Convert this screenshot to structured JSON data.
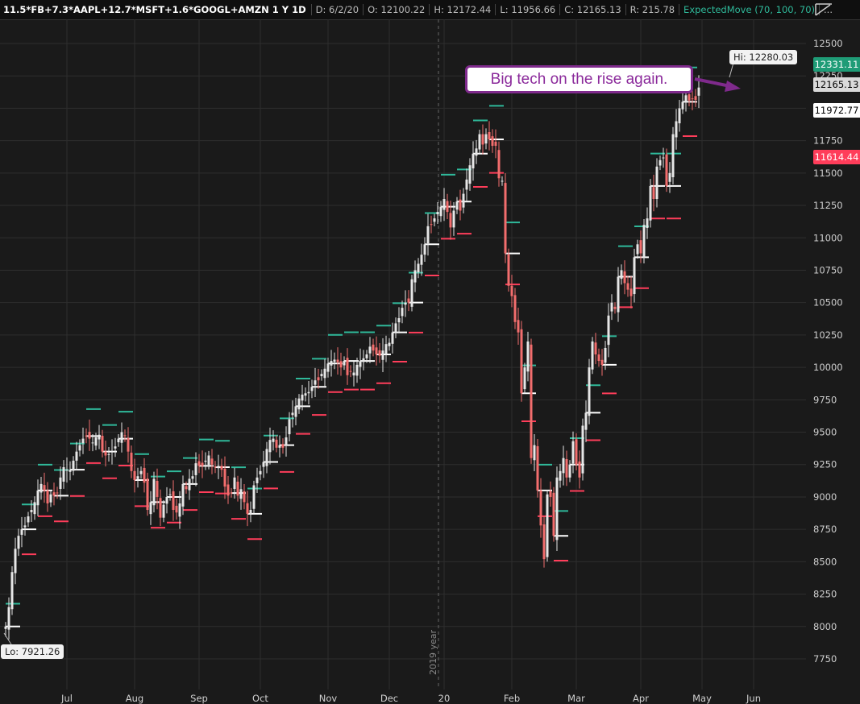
{
  "header": {
    "symbol": "11.5*FB+7.3*AAPL+12.7*MSFT+1.6*GOOGL+AMZN 1 Y 1D",
    "date": "D: 6/2/20",
    "open": "O: 12100.22",
    "high": "H: 12172.44",
    "low": "L: 11956.66",
    "close": "C: 12165.13",
    "range": "R: 215.78",
    "study": "ExpectedMove (70, 100, 70)",
    "more": "..."
  },
  "colors": {
    "up": "#e6e6e6",
    "down": "#f26d6d",
    "upper_band": "#2fb99a",
    "lower_band": "#ff3d5a",
    "background": "#1a1a1a",
    "grid": "#2e2e2e"
  },
  "annotation": {
    "text": "Big tech on the rise again."
  },
  "price_tags": [
    {
      "text": "12331.11",
      "bg": "#1f9c77",
      "fg": "#ffffff"
    },
    {
      "text": "12165.13",
      "bg": "#d9d9d9",
      "fg": "#000000"
    },
    {
      "text": "11972.77",
      "bg": "#ffffff",
      "fg": "#000000"
    },
    {
      "text": "11614.44",
      "bg": "#ff3d5a",
      "fg": "#ffffff"
    }
  ],
  "hi_label": "Hi: 12280.03",
  "lo_label": "Lo: 7921.26",
  "year_marker": "2019 year",
  "chart_data": {
    "type": "candlestick",
    "ylim": [
      7500,
      12600
    ],
    "y_ticks": [
      7750,
      8000,
      8250,
      8500,
      8750,
      9000,
      9250,
      9500,
      9750,
      10000,
      10250,
      10500,
      10750,
      11000,
      11250,
      11500,
      11750,
      12000,
      12250,
      12500
    ],
    "x_ticks": [
      "Jul",
      "Aug",
      "Sep",
      "Oct",
      "Nov",
      "Dec",
      "20",
      "Feb",
      "Mar",
      "Apr",
      "May",
      "Jun"
    ],
    "x_tick_index": [
      19,
      40,
      60,
      79,
      100,
      119,
      136,
      157,
      177,
      197,
      216,
      232
    ],
    "hi": 12280.03,
    "lo": 7921.26,
    "closes": [
      8000,
      8150,
      8420,
      8600,
      8700,
      8750,
      8780,
      8850,
      8900,
      8960,
      9050,
      9100,
      9050,
      8950,
      9020,
      9010,
      9030,
      9150,
      9230,
      9210,
      9210,
      9280,
      9350,
      9400,
      9450,
      9470,
      9450,
      9420,
      9460,
      9480,
      9350,
      9320,
      9330,
      9350,
      9390,
      9450,
      9500,
      9470,
      9350,
      9200,
      9130,
      9160,
      9200,
      9110,
      8900,
      8960,
      9140,
      9000,
      8840,
      8940,
      9000,
      9020,
      8900,
      8880,
      8950,
      9100,
      9060,
      9140,
      9160,
      9260,
      9240,
      9240,
      9280,
      9320,
      9250,
      9230,
      9240,
      9210,
      9080,
      9010,
      9030,
      9150,
      9010,
      9060,
      8960,
      8870,
      8900,
      9090,
      9150,
      9200,
      9270,
      9370,
      9440,
      9450,
      9380,
      9400,
      9380,
      9460,
      9600,
      9650,
      9700,
      9760,
      9790,
      9800,
      9810,
      9850,
      9900,
      9900,
      9950,
      9990,
      10030,
      10050,
      10060,
      10040,
      10000,
      10050,
      9940,
      9970,
      9960,
      10020,
      10050,
      10070,
      10100,
      10160,
      10130,
      10100,
      10090,
      10130,
      10180,
      10190,
      10270,
      10340,
      10380,
      10460,
      10500,
      10500,
      10680,
      10750,
      10800,
      10870,
      10950,
      11090,
      11100,
      11150,
      11200,
      11240,
      11300,
      11200,
      11080,
      11210,
      11280,
      11210,
      11340,
      11450,
      11560,
      11650,
      11690,
      11800,
      11720,
      11800,
      11760,
      11710,
      11710,
      11460,
      11440,
      10880,
      10630,
      10550,
      10350,
      10270,
      9800,
      10000,
      10200,
      9300,
      9400,
      9050,
      8780,
      8520,
      9020,
      9000,
      8700,
      9150,
      9200,
      9300,
      9150,
      9250,
      9430,
      9250,
      9150,
      9550,
      9650,
      10000,
      10200,
      10100,
      10050,
      10020,
      10150,
      10400,
      10500,
      10450,
      10700,
      10750,
      10650,
      10600,
      10550,
      10850,
      10950,
      10880,
      11100,
      11150,
      11400,
      11300,
      11550,
      11600,
      11620,
      11400,
      11500,
      11800,
      11900,
      12000,
      12050,
      12100,
      12060,
      12070,
      12065,
      12160
    ]
  }
}
